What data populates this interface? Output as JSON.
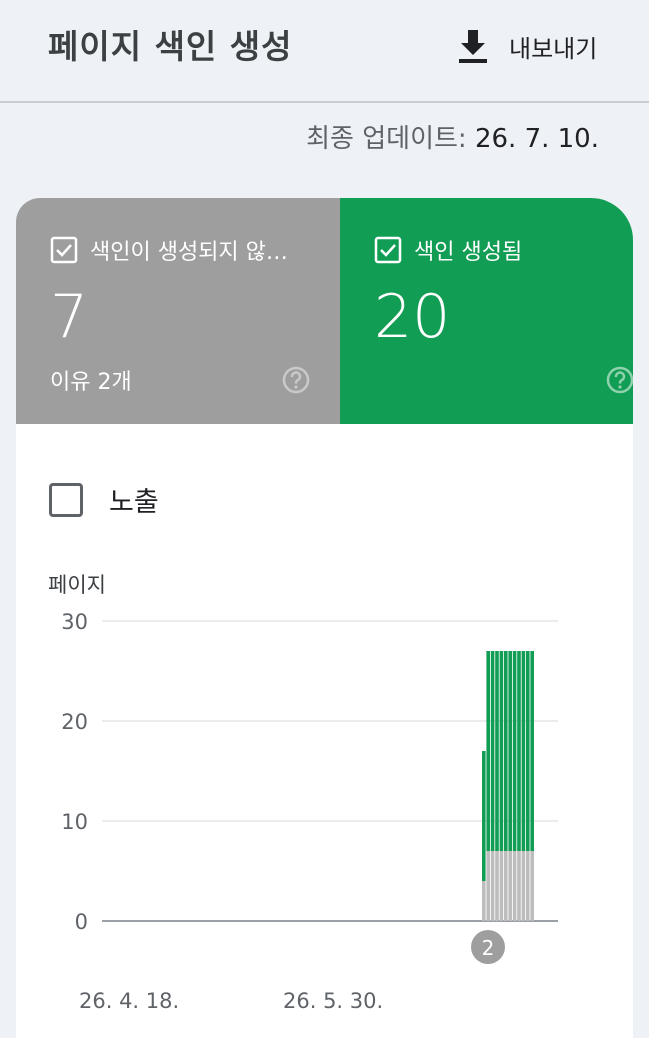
{
  "header": {
    "title": "페이지 색인 생성",
    "export_label": "내보내기"
  },
  "updated": {
    "label": "최종 업데이트:",
    "date": "26. 7. 10."
  },
  "tiles": [
    {
      "label": "색인이 생성되지 않…",
      "value": "7",
      "sub": "이유 2개",
      "color": "#9e9e9e",
      "checked": true
    },
    {
      "label": "색인 생성됨",
      "value": "20",
      "sub": "",
      "color": "#129d55",
      "checked": true
    }
  ],
  "impressions": {
    "label": "노출",
    "checked": false
  },
  "chart_data": {
    "type": "bar",
    "stacked": true,
    "ylabel": "페이지",
    "ylim": [
      0,
      30
    ],
    "yticks": [
      0,
      10,
      20,
      30
    ],
    "xtick_labels": [
      "26. 4. 18.",
      "26. 5. 30."
    ],
    "annotation": {
      "label": "2"
    },
    "grid": true,
    "series": [
      {
        "values": [
          4,
          7,
          7,
          7,
          7,
          7,
          7,
          7,
          7,
          7,
          7,
          7
        ],
        "color": "#bdbdbd"
      },
      {
        "values": [
          13,
          20,
          20,
          20,
          20,
          20,
          20,
          20,
          20,
          20,
          20,
          20
        ],
        "color": "#129d55"
      }
    ]
  }
}
